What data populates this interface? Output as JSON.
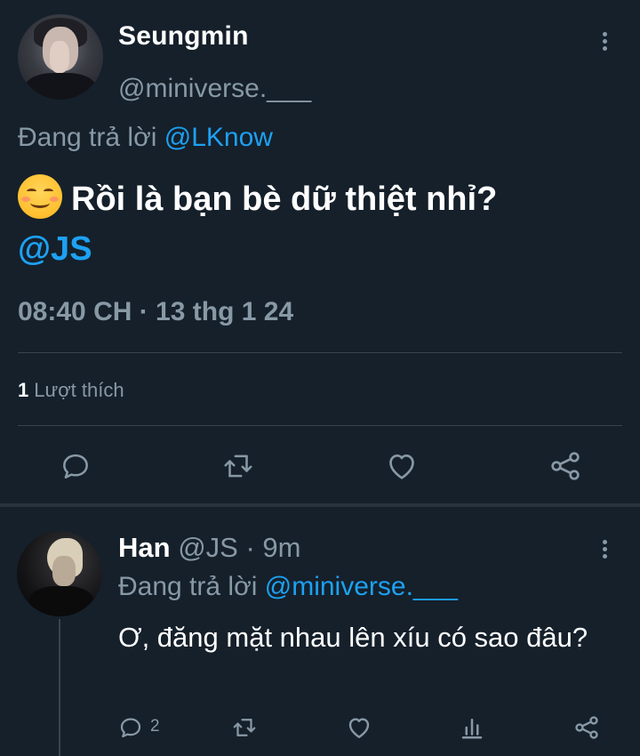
{
  "main_tweet": {
    "display_name": "Seungmin",
    "handle": "@miniverse.___",
    "reply_prefix": "Đang trả lời",
    "reply_to": "@LKnow",
    "text": "Rồi là bạn bè dữ thiệt nhỉ?",
    "text_mention": "@JS",
    "timestamp": "08:40 CH · 13 thg 1 24",
    "likes_count": "1",
    "likes_label": "Lượt thích",
    "actions": [
      "reply-icon",
      "retweet-icon",
      "like-icon",
      "share-icon"
    ]
  },
  "reply_tweet": {
    "display_name": "Han",
    "meta": "@JS · 9m",
    "reply_prefix": "Đang trả lời",
    "reply_to": "@miniverse.___",
    "text": "Ơ, đăng mặt nhau lên xíu có sao đâu?",
    "reply_count": "2",
    "actions": [
      "reply-icon",
      "retweet-icon",
      "like-icon",
      "analytics-icon",
      "share-icon"
    ]
  },
  "colors": {
    "background": "#15202b",
    "secondary_text": "#8899a6",
    "accent": "#1da1f2",
    "divider": "#38444d"
  }
}
